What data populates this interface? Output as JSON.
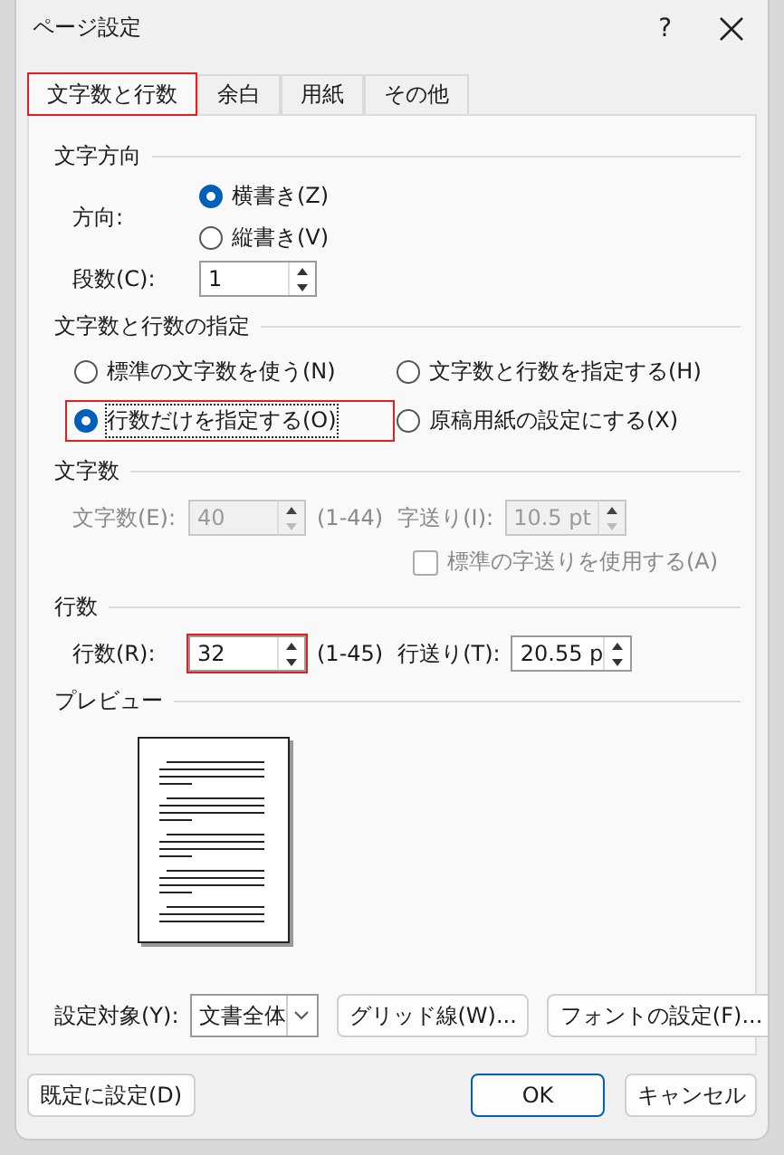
{
  "window": {
    "title": "ページ設定",
    "help": "?"
  },
  "tabs": [
    {
      "label": "文字数と行数",
      "selected": true,
      "highlighted": true
    },
    {
      "label": "余白",
      "selected": false,
      "highlighted": false
    },
    {
      "label": "用紙",
      "selected": false,
      "highlighted": false
    },
    {
      "label": "その他",
      "selected": false,
      "highlighted": false
    }
  ],
  "text_direction": {
    "heading": "文字方向",
    "direction_label": "方向:",
    "options": [
      {
        "label": "横書き(Z)",
        "selected": true
      },
      {
        "label": "縦書き(V)",
        "selected": false
      }
    ],
    "columns_label": "段数(C):",
    "columns_value": "1"
  },
  "grid_mode": {
    "heading": "文字数と行数の指定",
    "options": [
      {
        "label": "標準の文字数を使う(N)",
        "selected": false,
        "highlighted": false
      },
      {
        "label": "文字数と行数を指定する(H)",
        "selected": false,
        "highlighted": false
      },
      {
        "label": "行数だけを指定する(O)",
        "selected": true,
        "highlighted": true
      },
      {
        "label": "原稿用紙の設定にする(X)",
        "selected": false,
        "highlighted": false
      }
    ]
  },
  "chars": {
    "heading": "文字数",
    "disabled": true,
    "count_label": "文字数(E):",
    "count_value": "40",
    "count_range": "(1-44)",
    "pitch_label": "字送り(I):",
    "pitch_value": "10.5 pt",
    "standard_pitch": {
      "label": "標準の字送りを使用する(A)",
      "checked": false
    }
  },
  "lines": {
    "heading": "行数",
    "count_label": "行数(R):",
    "count_value": "32",
    "count_highlighted": true,
    "count_range": "(1-45)",
    "pitch_label": "行送り(T):",
    "pitch_value": "20.55 p"
  },
  "preview": {
    "heading": "プレビュー"
  },
  "apply_to": {
    "label": "設定対象(Y):",
    "value": "文書全体"
  },
  "panel_buttons": [
    "グリッド線(W)...",
    "フォントの設定(F)..."
  ],
  "footer": {
    "default_button": "既定に設定(D)",
    "ok": "OK",
    "cancel": "キャンセル"
  }
}
